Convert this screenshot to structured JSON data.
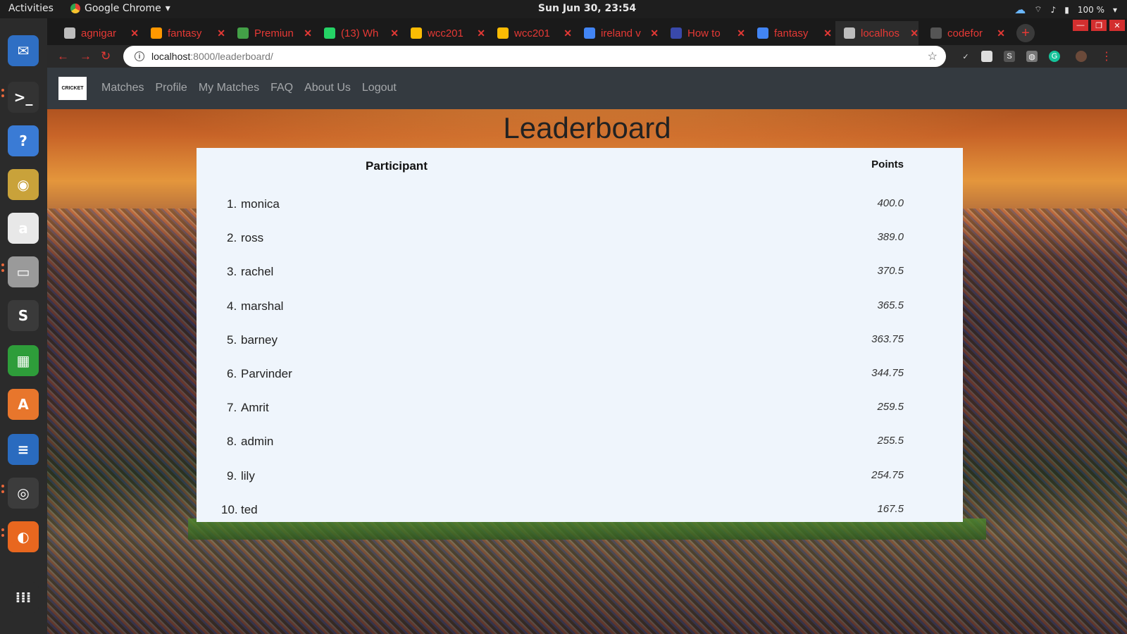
{
  "system": {
    "activities": "Activities",
    "app_name": "Google Chrome",
    "clock": "Sun Jun 30, 23:54",
    "battery": "100 %"
  },
  "browser": {
    "tabs": [
      {
        "label": "agnigar",
        "color": "#bdbdbd"
      },
      {
        "label": "fantasy",
        "color": "#ff9800"
      },
      {
        "label": "Premiun",
        "color": "#43a047"
      },
      {
        "label": "(13) Wh",
        "color": "#25d366"
      },
      {
        "label": "wcc201",
        "color": "#fbbc04"
      },
      {
        "label": "wcc201",
        "color": "#fbbc04"
      },
      {
        "label": "ireland v",
        "color": "#4285f4"
      },
      {
        "label": "How to",
        "color": "#3949ab"
      },
      {
        "label": "fantasy",
        "color": "#4285f4"
      },
      {
        "label": "localhos",
        "color": "#bdbdbd"
      },
      {
        "label": "codefor",
        "color": "#555555"
      }
    ],
    "url_host": "localhost",
    "url_path": ":8000/leaderboard/"
  },
  "site": {
    "logo_text": "CRICKET",
    "nav": [
      "Matches",
      "Profile",
      "My Matches",
      "FAQ",
      "About Us",
      "Logout"
    ]
  },
  "leaderboard": {
    "title": "Leaderboard",
    "header_participant": "Participant",
    "header_points": "Points",
    "rows": [
      {
        "rank": "1.",
        "name": "monica",
        "points": "400.0"
      },
      {
        "rank": "2.",
        "name": "ross",
        "points": "389.0"
      },
      {
        "rank": "3.",
        "name": "rachel",
        "points": "370.5"
      },
      {
        "rank": "4.",
        "name": "marshal",
        "points": "365.5"
      },
      {
        "rank": "5.",
        "name": "barney",
        "points": "363.75"
      },
      {
        "rank": "6.",
        "name": "Parvinder",
        "points": "344.75"
      },
      {
        "rank": "7.",
        "name": "Amrit",
        "points": "259.5"
      },
      {
        "rank": "8.",
        "name": "admin",
        "points": "255.5"
      },
      {
        "rank": "9.",
        "name": "lily",
        "points": "254.75"
      },
      {
        "rank": "10.",
        "name": "ted",
        "points": "167.5"
      }
    ]
  },
  "dock": [
    {
      "name": "thunderbird-icon",
      "glyph": "✉",
      "color": "#2f6fc4"
    },
    {
      "name": "terminal-icon",
      "glyph": ">_",
      "color": "#333333"
    },
    {
      "name": "help-icon",
      "glyph": "?",
      "color": "#3a7bd5"
    },
    {
      "name": "rhythmbox-icon",
      "glyph": "◉",
      "color": "#c9a23a"
    },
    {
      "name": "amazon-icon",
      "glyph": "a",
      "color": "#e8e8e8"
    },
    {
      "name": "files-icon",
      "glyph": "▭",
      "color": "#9a9a9a"
    },
    {
      "name": "sublime-icon",
      "glyph": "S",
      "color": "#3a3a3a"
    },
    {
      "name": "spreadsheet-icon",
      "glyph": "▦",
      "color": "#2e9d3a"
    },
    {
      "name": "software-center-icon",
      "glyph": "A",
      "color": "#e8762c"
    },
    {
      "name": "writer-icon",
      "glyph": "≡",
      "color": "#2a6bbf"
    },
    {
      "name": "chrome-icon",
      "glyph": "◎",
      "color": "#3c3c3c"
    },
    {
      "name": "firefox-icon",
      "glyph": "◐",
      "color": "#e8671f"
    },
    {
      "name": "app-grid-icon",
      "glyph": "⁞⁞⁞",
      "color": "#2b2b2b"
    }
  ]
}
